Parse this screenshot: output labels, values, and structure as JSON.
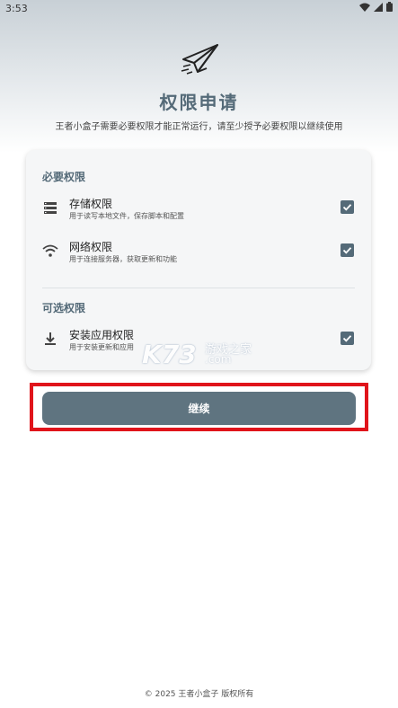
{
  "status_bar": {
    "time": "3:53"
  },
  "header": {
    "title": "权限申请",
    "subtitle": "王者小盒子需要必要权限才能正常运行，请至少授予必要权限以继续使用"
  },
  "required_section": {
    "title": "必要权限",
    "items": [
      {
        "name": "存储权限",
        "desc": "用于读写本地文件，保存脚本和配置",
        "icon": "storage-icon",
        "checked": true
      },
      {
        "name": "网络权限",
        "desc": "用于连接服务器，获取更新和功能",
        "icon": "wifi-icon",
        "checked": true
      }
    ]
  },
  "optional_section": {
    "title": "可选权限",
    "items": [
      {
        "name": "安装应用权限",
        "desc": "用于安装更新和应用",
        "icon": "download-icon",
        "checked": true
      }
    ]
  },
  "watermark": {
    "logo": "K73",
    "text": "游戏之家",
    "domain": ".com"
  },
  "continue_label": "继续",
  "footer": "© 2025 王者小盒子 版权所有",
  "colors": {
    "accent": "#546a78",
    "button": "#5f7480",
    "highlight": "#e0141b"
  }
}
